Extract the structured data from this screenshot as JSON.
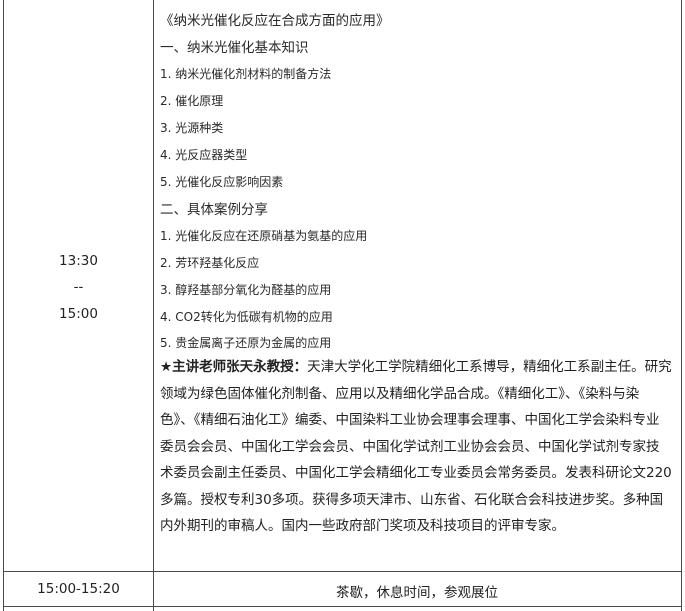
{
  "row1": {
    "time": {
      "start": "13:30",
      "sep": "--",
      "end": "15:00"
    },
    "title": "《纳米光催化反应在合成方面的应用》",
    "section1": "一、纳米光催化基本知识",
    "items1": [
      "1. 纳米光催化剂材料的制备方法",
      "2. 催化原理",
      "3. 光源种类",
      "4. 光反应器类型",
      "5. 光催化反应影响因素"
    ],
    "section2": "二、具体案例分享",
    "items2": [
      "1. 光催化反应在还原硝基为氨基的应用",
      "2. 芳环羟基化反应",
      "3. 醇羟基部分氧化为醛基的应用",
      "4. CO2转化为低碳有机物的应用",
      "5. 贵金属离子还原为金属的应用"
    ],
    "lecturer_label": "★主讲老师张天永教授：",
    "lecturer_bio": "天津大学化工学院精细化工系博导，精细化工系副主任。研究领域为绿色固体催化剂制备、应用以及精细化学品合成。《精细化工》、《染料与染色》、《精细石油化工》编委、中国染料工业协会理事会理事、中国化工学会染料专业委员会会员、中国化工学会会员、中国化学试剂工业协会会员、中国化学试剂专家技术委员会副主任委员、中国化工学会精细化工专业委员会常务委员。发表科研论文220多篇。授权专利30多项。获得多项天津市、山东省、石化联合会科技进步奖。多种国内外期刊的审稿人。国内一些政府部门奖项及科技项目的评审专家。"
  },
  "row2": {
    "time": "15:00-15:20",
    "content": "茶歇，休息时间，参观展位"
  }
}
